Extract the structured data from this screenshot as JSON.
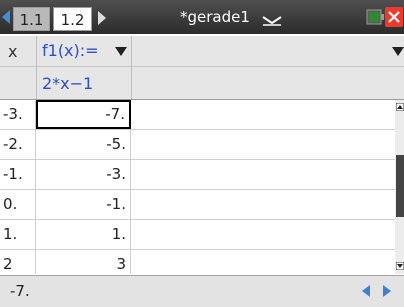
{
  "titlebar": {
    "tabs": [
      {
        "label": "1.1",
        "active": false
      },
      {
        "label": "1.2",
        "active": true
      }
    ],
    "document_title": "*gerade1",
    "icons": [
      "arrow-left-icon",
      "arrow-right-icon",
      "chevron-down-icon",
      "battery-icon",
      "close-icon"
    ]
  },
  "header": {
    "x_column": "x",
    "function_label": "f1(x):=",
    "expression": "2*x−1"
  },
  "table": {
    "rows": [
      {
        "x": "-3.",
        "y": "-7."
      },
      {
        "x": "-2.",
        "y": "-5."
      },
      {
        "x": "-1.",
        "y": "-3."
      },
      {
        "x": "0.",
        "y": "-1."
      },
      {
        "x": "1.",
        "y": "1."
      },
      {
        "x": "2",
        "y": "3"
      }
    ],
    "selected_row": 0
  },
  "status": {
    "entry_value": "-7."
  },
  "colors": {
    "accent_blue": "#3a82d6",
    "function_text": "#2a4fc8",
    "close_red": "#ee3a2a"
  }
}
